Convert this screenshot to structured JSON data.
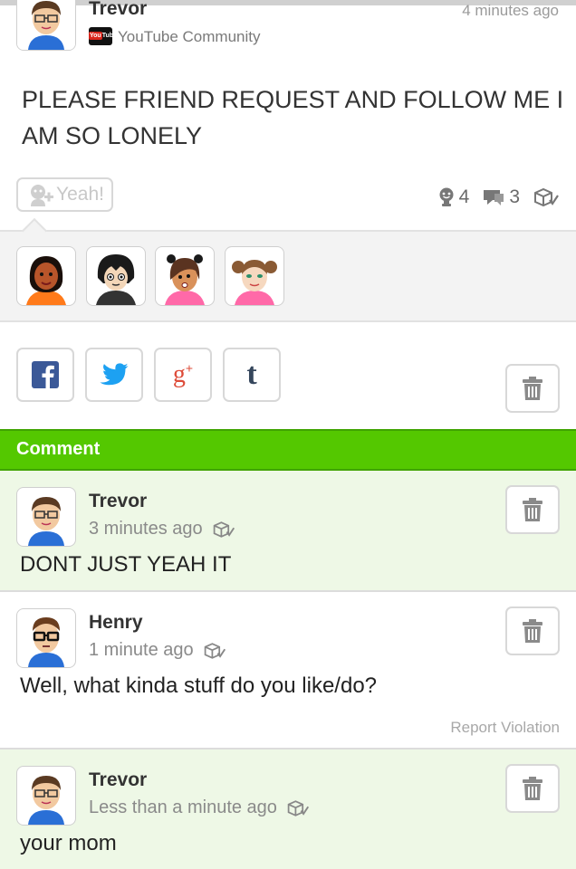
{
  "post": {
    "author": "Trevor",
    "time": "4 minutes ago",
    "community": "YouTube Community",
    "community_icon": "youtube-logo",
    "text": "PLEASE FRIEND REQUEST AND FOLLOW ME I AM SO LONELY",
    "yeah_label": "Yeah!",
    "yeah_count": "4",
    "comment_count": "3"
  },
  "yeahers": [
    {
      "name": "mii-1"
    },
    {
      "name": "mii-2"
    },
    {
      "name": "mii-3"
    },
    {
      "name": "mii-4"
    }
  ],
  "share": [
    "facebook-icon",
    "twitter-icon",
    "google-plus-icon",
    "tumblr-icon"
  ],
  "comment_section": {
    "label": "Comment"
  },
  "comments": [
    {
      "author": "Trevor",
      "time": "3 minutes ago",
      "text": "DONT JUST YEAH IT"
    },
    {
      "author": "Henry",
      "time": "1 minute ago",
      "text": "Well, what kinda stuff do you like/do?",
      "report_label": "Report Violation"
    },
    {
      "author": "Trevor",
      "time": "Less than a minute ago",
      "text": "your mom"
    }
  ],
  "colors": {
    "accent_green": "#54c800",
    "comment_bg": "#eef8e6",
    "facebook": "#3b5998",
    "twitter": "#1da1f2",
    "gplus": "#dd4b39",
    "tumblr": "#35465c"
  }
}
